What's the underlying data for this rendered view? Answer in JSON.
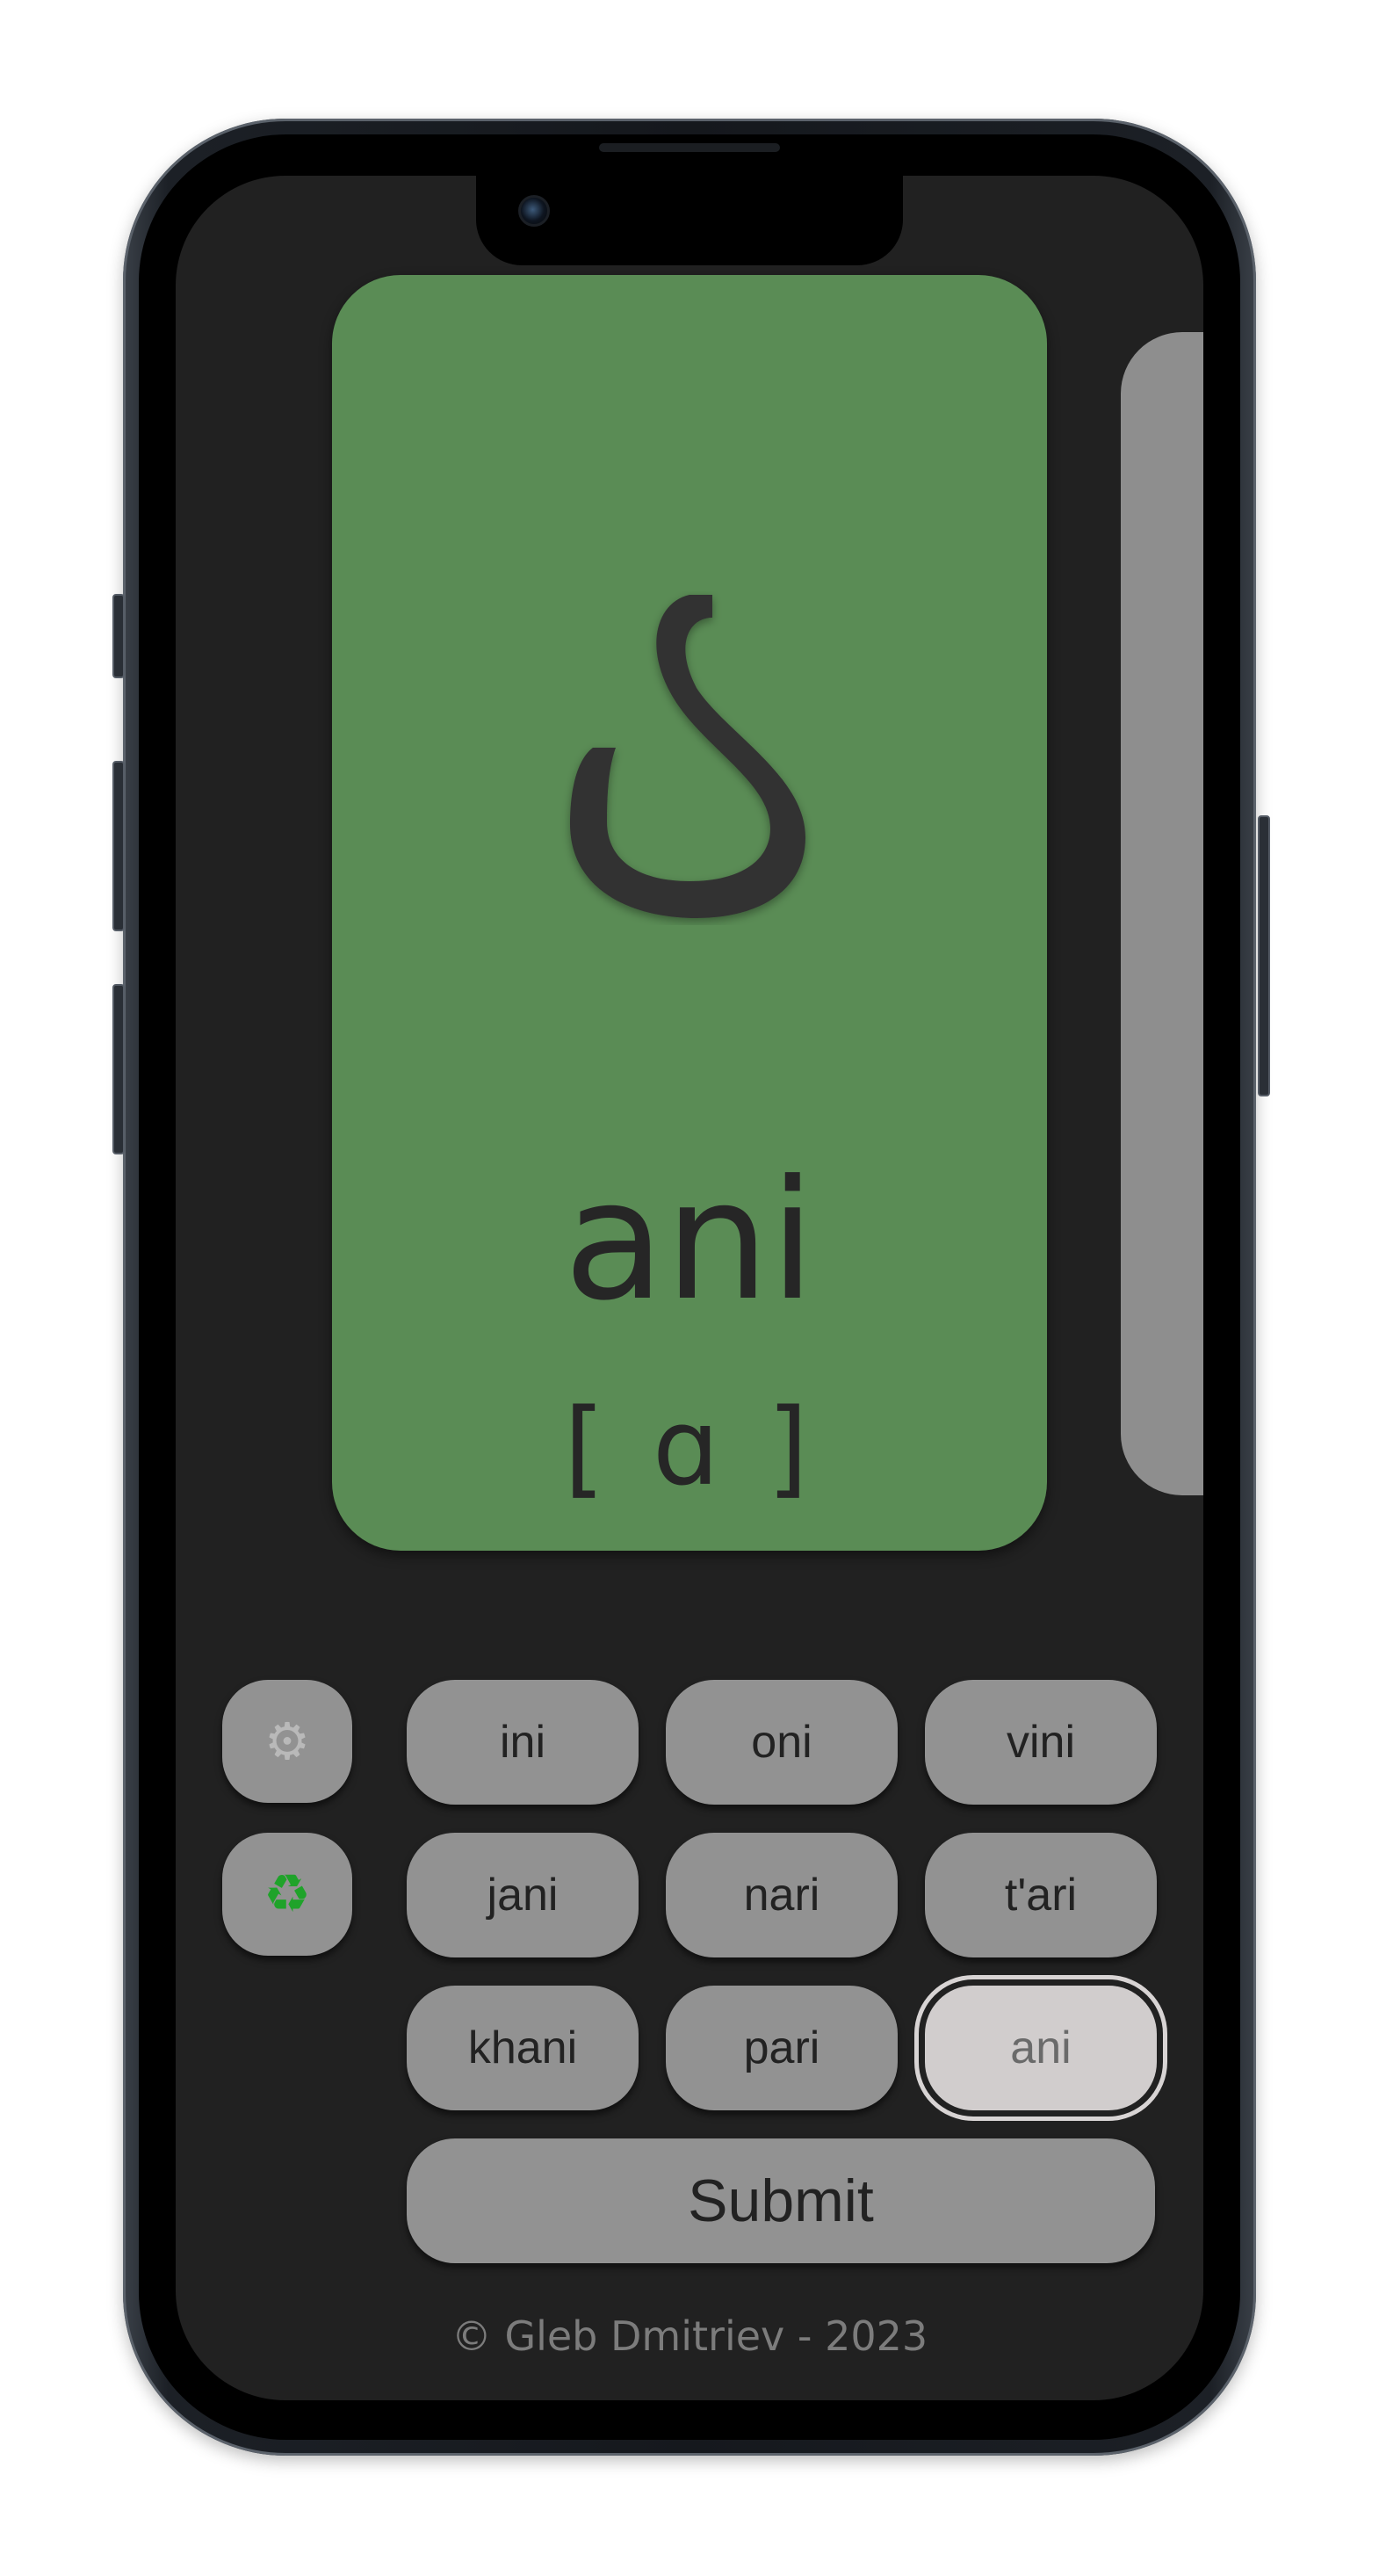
{
  "card": {
    "letter": "ა",
    "word": "ani",
    "ipa": "[ ɑ ]",
    "background": "#5a8c55"
  },
  "side_buttons": [
    {
      "icon": "gear-icon",
      "glyph": "⚙"
    },
    {
      "icon": "recycle-icon",
      "glyph": "♻"
    }
  ],
  "options": [
    "ini",
    "oni",
    "vini",
    "jani",
    "nari",
    "t'ari",
    "khani",
    "pari",
    "ani"
  ],
  "selected_option": "ani",
  "submit_label": "Submit",
  "footer": "© Gleb Dmitriev - 2023",
  "colors": {
    "screen_bg": "#212121",
    "button_bg": "#929292",
    "selected_bg": "#d1cdcd",
    "next_card": "#8e8e8e"
  }
}
